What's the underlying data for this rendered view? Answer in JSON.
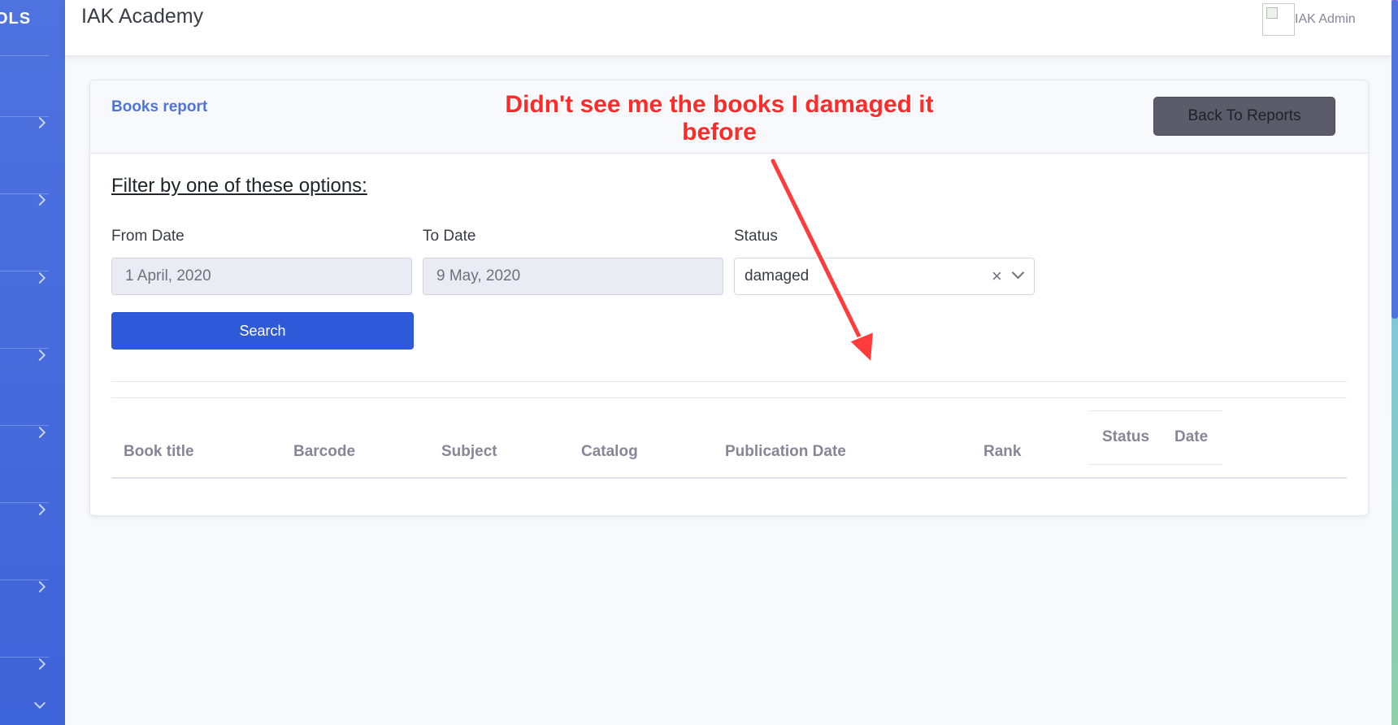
{
  "sidebar": {
    "brand": "OLS",
    "nav_item_count": 8
  },
  "topbar": {
    "app_title": "IAK Academy",
    "user_name": "IAK Admin"
  },
  "report": {
    "title": "Books report",
    "back_button": "Back To Reports",
    "filter_heading": "Filter by one of these options:",
    "from_date_label": "From Date",
    "from_date_value": "1 April, 2020",
    "to_date_label": "To Date",
    "to_date_value": "9 May, 2020",
    "status_label": "Status",
    "status_value": "damaged",
    "search_button": "Search",
    "table_headers": {
      "book_title": "Book title",
      "barcode": "Barcode",
      "subject": "Subject",
      "catalog": "Catalog",
      "publication_date": "Publication Date",
      "rank": "Rank",
      "status": "Status",
      "date": "Date"
    }
  },
  "annotation": {
    "text": "Didn't see me the books I damaged it before",
    "color": "#ff2b2b"
  },
  "colors": {
    "sidebar": "#4e73df",
    "primary_button": "#2e59d9",
    "secondary_button": "#5a5c69"
  }
}
